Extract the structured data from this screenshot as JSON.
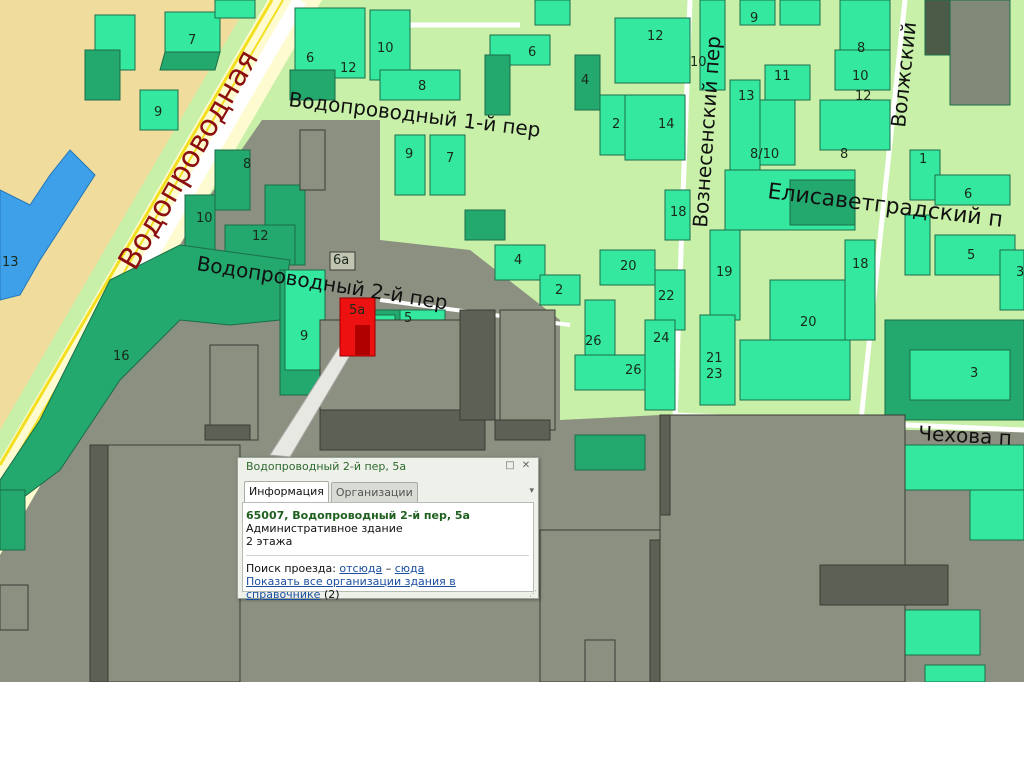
{
  "streets": {
    "main_road": "Водопроводная",
    "lane1": "Водопроводный 1-й пер",
    "lane2": "Водопроводный 2-й пер",
    "voznesensky": "Вознесенский пер",
    "volzhsky": "Волжский",
    "elisavetgradsky": "Елисаветградский п",
    "chekhova": "Чехова п"
  },
  "house_numbers": {
    "n7": "7",
    "n9a": "9",
    "n13": "13",
    "n6a": "6",
    "n12a": "12",
    "n10a": "10",
    "n8a": "8",
    "n6b": "6",
    "n4a": "4",
    "n9b": "9",
    "n7b": "7",
    "n8b": "8",
    "n10b": "10",
    "n12b": "12",
    "n16": "16",
    "n6a_label": "6а",
    "n5a_label": "5а",
    "n5": "5",
    "n9c": "9",
    "n12c": "12",
    "n10c": "10",
    "n2a": "2",
    "n14": "14",
    "n4b": "4",
    "n2b": "2",
    "n9d": "9",
    "n11": "11",
    "n13b": "13",
    "n810": "8/10",
    "n8c": "8",
    "n12d": "12",
    "n10d": "10",
    "n8d": "8",
    "n1": "1",
    "n6c": "6",
    "n18a": "18",
    "n20a": "20",
    "n22": "22",
    "n26a": "26",
    "n24": "24",
    "n26b": "26",
    "n19": "19",
    "n21": "21",
    "n23": "23",
    "n20b": "20",
    "n18b": "18",
    "n5b": "5",
    "n3a": "3",
    "n3b": "3"
  },
  "popup": {
    "title": "Водопроводный 2-й пер, 5а",
    "restore_icon": "□",
    "close_icon": "✕",
    "tabs": [
      {
        "label": "Информация",
        "active": true
      },
      {
        "label": "Организации",
        "active": false
      }
    ],
    "tab_menu_icon": "▾",
    "address": "65007, Водопроводный 2-й пер, 5а",
    "building_type": "Административное здание",
    "floors": "2 этажа",
    "route_prefix": "Поиск проезда:",
    "route_from": "отсюда",
    "route_dash": "–",
    "route_to": "сюда",
    "show_orgs_link": "Показать все организации здания в справочнике",
    "orgs_count": "(2)",
    "resize_icon": "⋰"
  },
  "colors": {
    "park": "#c8f0a8",
    "residential_top": "#34e8a0",
    "residential_side": "#23a86e",
    "industrial_top": "#8c9080",
    "industrial_side": "#5d6055",
    "selected_building": "#ee1111",
    "blue_building": "#3ea0e8",
    "road_main": "#fffbd0",
    "sand": "#f0dc9c"
  }
}
